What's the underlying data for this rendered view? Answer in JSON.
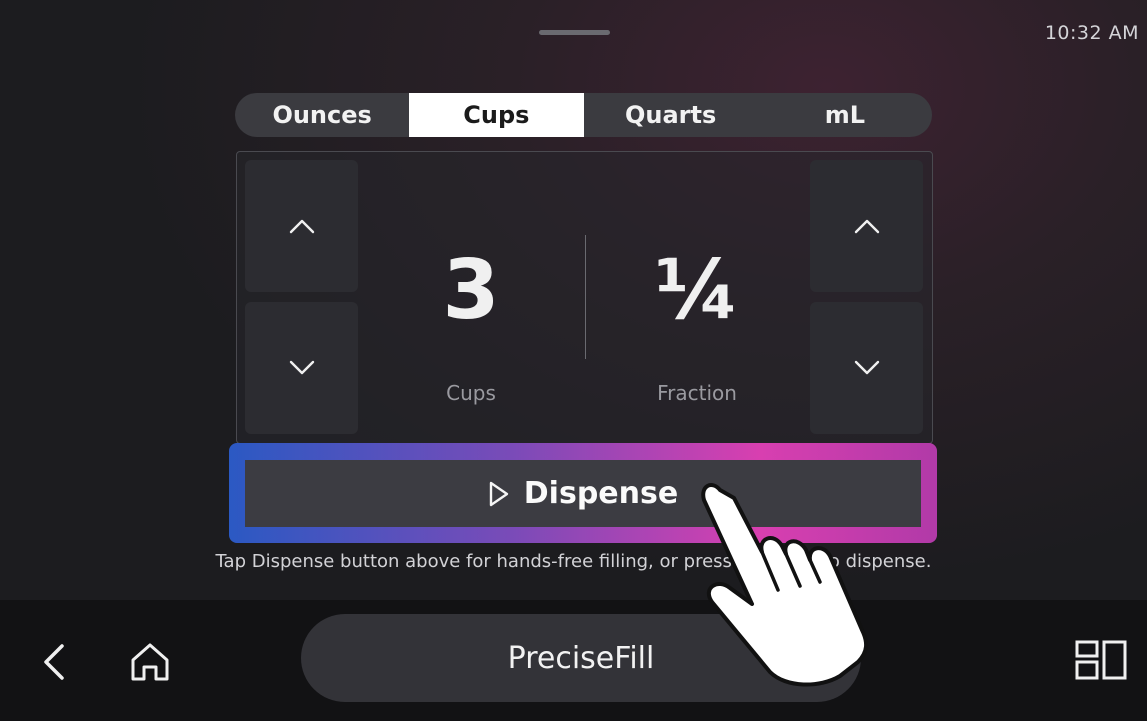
{
  "status": {
    "time": "10:32 AM"
  },
  "units": {
    "tabs": [
      {
        "label": "Ounces"
      },
      {
        "label": "Cups"
      },
      {
        "label": "Quarts"
      },
      {
        "label": "mL"
      }
    ],
    "selected": "Cups"
  },
  "amount": {
    "whole_value": "3",
    "whole_label": "Cups",
    "fraction_value": "¼",
    "fraction_label": "Fraction"
  },
  "dispense": {
    "label": "Dispense",
    "icon": "play-outline-icon"
  },
  "hint": "Tap Dispense button above for hands-free filling, or press and hold to dispense.",
  "bottom_nav": {
    "app_name": "PreciseFill",
    "icons": [
      "chevron-left-icon",
      "home-icon",
      "layout-icon"
    ]
  },
  "colors": {
    "dispense_gradient": [
      "#2b59c3",
      "#7a4bb8",
      "#d83fb0",
      "#b13aa8"
    ],
    "selected_tab_bg": "#ffffff"
  }
}
